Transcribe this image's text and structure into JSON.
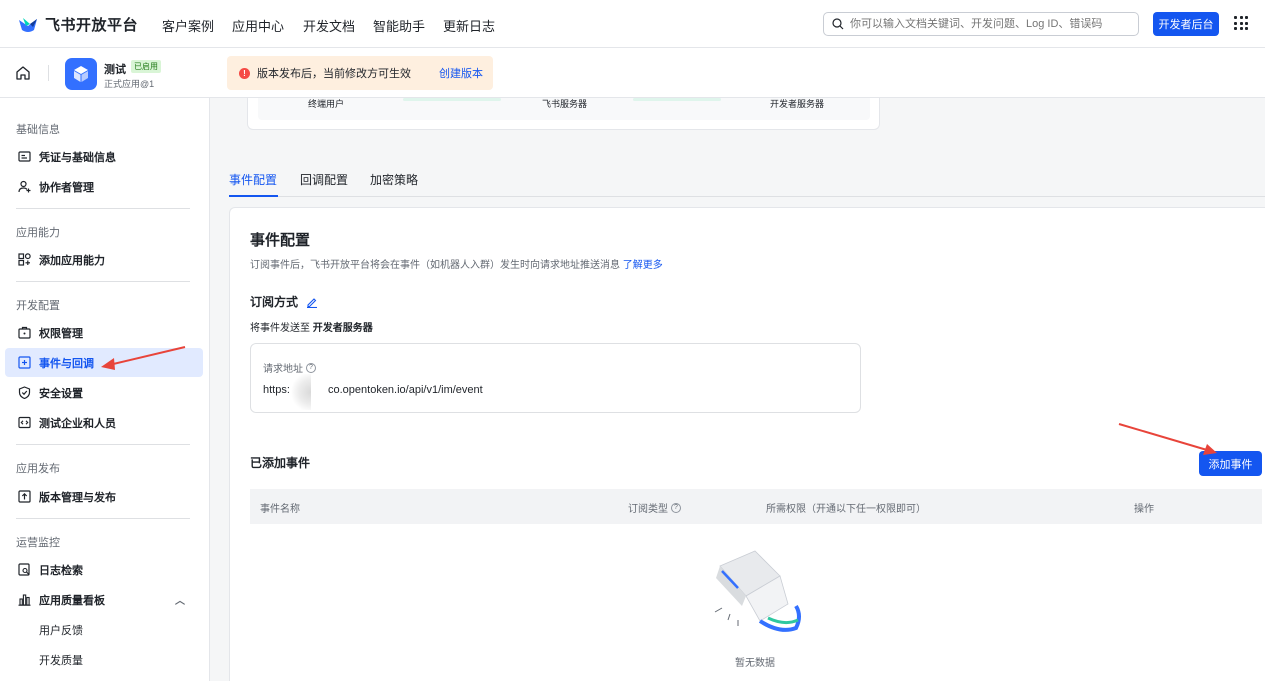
{
  "topnav": {
    "logo_text": "飞书开放平台",
    "links": [
      "客户案例",
      "应用中心",
      "开发文档",
      "智能助手",
      "更新日志"
    ],
    "search_placeholder": "你可以输入文档关键词、开发问题、Log ID、错误码",
    "dev_console_label": "开发者后台"
  },
  "app": {
    "name": "测试",
    "status_badge": "已启用",
    "version": "正式应用@1"
  },
  "notice": {
    "text": "版本发布后，当前修改方可生效",
    "link": "创建版本"
  },
  "sidebar": {
    "sections": [
      {
        "title": "基础信息",
        "items": [
          {
            "label": "凭证与基础信息",
            "icon": "credential-icon"
          },
          {
            "label": "协作者管理",
            "icon": "user-add-icon"
          }
        ]
      },
      {
        "title": "应用能力",
        "items": [
          {
            "label": "添加应用能力",
            "icon": "apps-add-icon"
          }
        ]
      },
      {
        "title": "开发配置",
        "items": [
          {
            "label": "权限管理",
            "icon": "permission-icon"
          },
          {
            "label": "事件与回调",
            "icon": "event-icon",
            "active": true
          },
          {
            "label": "安全设置",
            "icon": "shield-icon"
          },
          {
            "label": "测试企业和人员",
            "icon": "code-icon"
          }
        ]
      },
      {
        "title": "应用发布",
        "items": [
          {
            "label": "版本管理与发布",
            "icon": "upload-icon"
          }
        ]
      },
      {
        "title": "运营监控",
        "items": [
          {
            "label": "日志检索",
            "icon": "log-search-icon"
          },
          {
            "label": "应用质量看板",
            "icon": "chart-icon"
          }
        ]
      }
    ],
    "sub_items": [
      "用户反馈",
      "开发质量"
    ]
  },
  "flow": {
    "labels": [
      "终端用户",
      "飞书服务器",
      "开发者服务器"
    ]
  },
  "tabs": [
    "事件配置",
    "回调配置",
    "加密策略"
  ],
  "event_config": {
    "title": "事件配置",
    "desc": "订阅事件后，飞书开放平台将会在事件（如机器人入群）发生时向请求地址推送消息",
    "learn_more": "了解更多",
    "subscribe_title": "订阅方式",
    "send_to_prefix": "将事件发送至",
    "send_to_target": "开发者服务器",
    "url_label": "请求地址",
    "url_prefix": "https:",
    "url_rest": "co.opentoken.io/api/v1/im/event",
    "added_title": "已添加事件",
    "add_button": "添加事件",
    "columns": [
      "事件名称",
      "订阅类型",
      "所需权限（开通以下任一权限即可）",
      "操作"
    ],
    "empty_text": "暂无数据"
  },
  "colors": {
    "primary": "#1456f0",
    "active_bg": "#e1eaff",
    "annotation_arrow": "#e8443a"
  }
}
